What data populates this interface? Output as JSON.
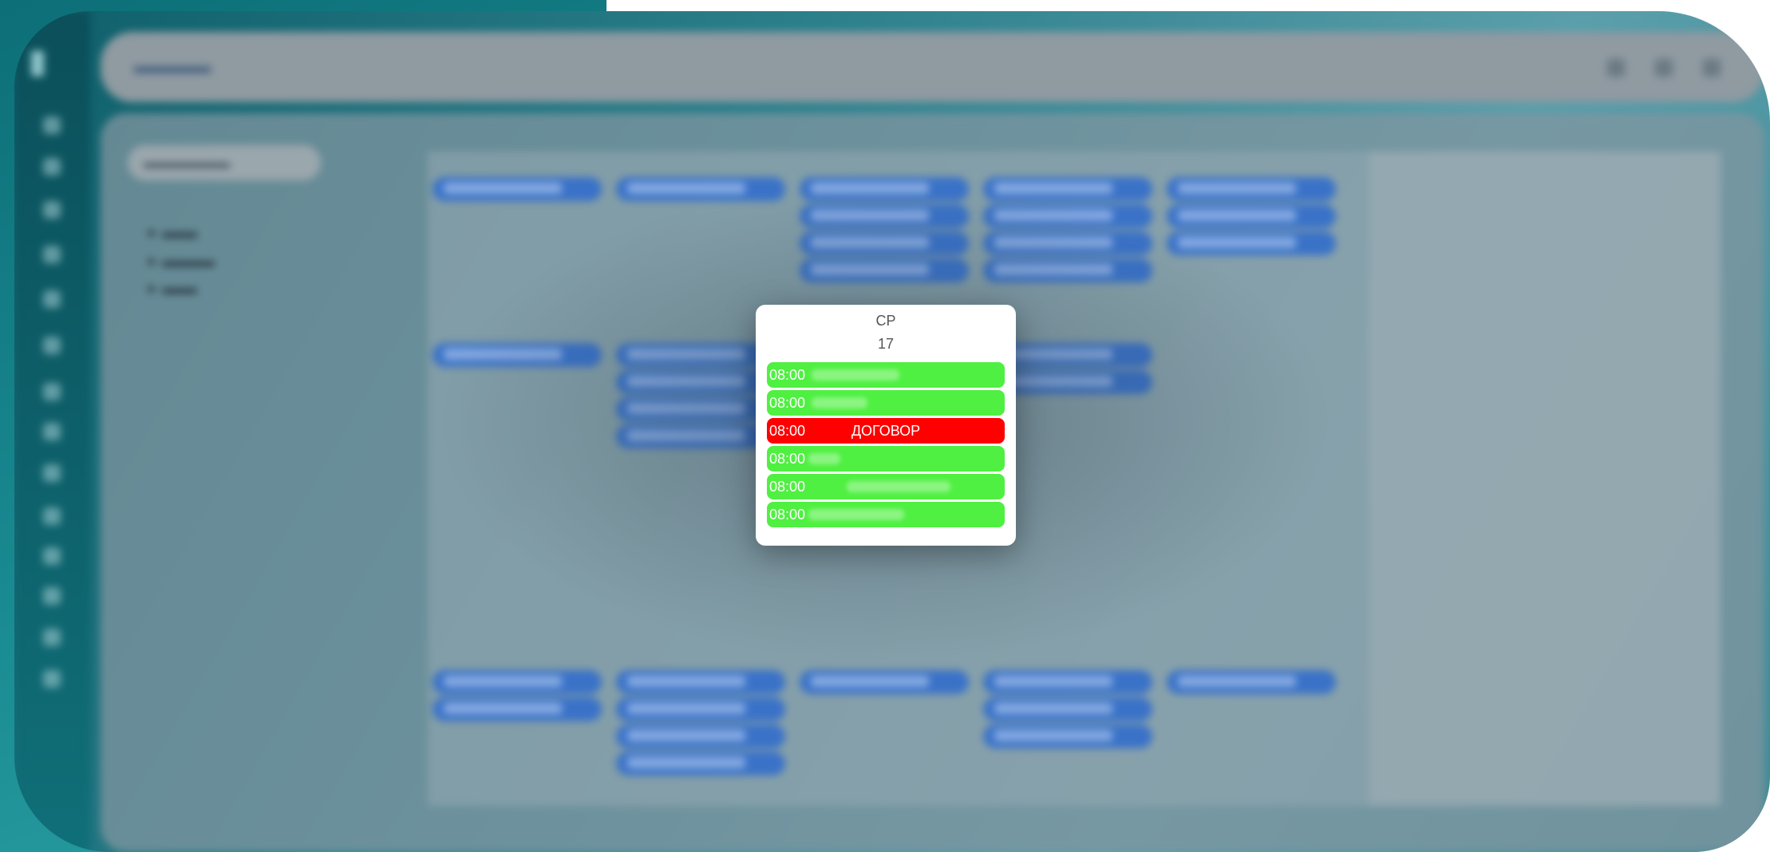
{
  "popup": {
    "weekday": "СР",
    "day": "17",
    "events": [
      {
        "time": "08:00",
        "title": "",
        "status_color": "#4ff041"
      },
      {
        "time": "08:00",
        "title": "",
        "status_color": "#4ff041"
      },
      {
        "time": "08:00",
        "title": "ДОГОВОР",
        "status_color": "#ff0000"
      },
      {
        "time": "08:00",
        "title": "",
        "status_color": "#4ff041"
      },
      {
        "time": "08:00",
        "title": "",
        "status_color": "#4ff041"
      },
      {
        "time": "08:00",
        "title": "",
        "status_color": "#4ff041"
      }
    ]
  },
  "colors": {
    "event_green": "#4ff041",
    "event_red": "#ff0000",
    "calendar_event_blue": "#3a72c8"
  }
}
